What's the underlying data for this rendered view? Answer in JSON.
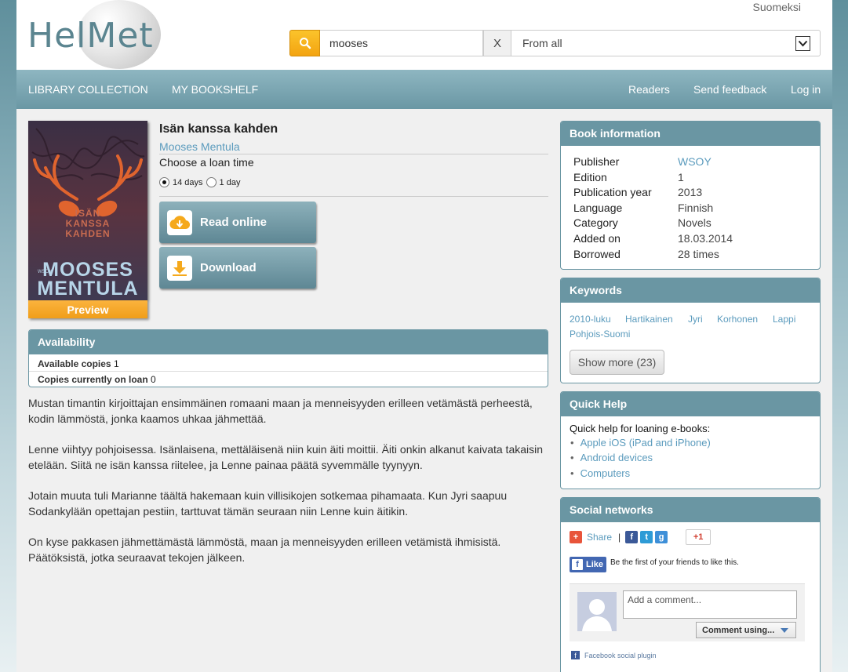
{
  "header": {
    "logo_text": "HelMet",
    "language_link": "Suomeksi",
    "search_value": "mooses",
    "clear_label": "X",
    "scope_value": "From all"
  },
  "nav": {
    "left": [
      "LIBRARY COLLECTION",
      "MY BOOKSHELF"
    ],
    "right": [
      "Readers",
      "Send feedback",
      "Log in"
    ]
  },
  "cover": {
    "title_lines": [
      "ISÄN",
      "KANSSA",
      "KAHDEN"
    ],
    "author_lines": [
      "MOOSES",
      "MENTULA"
    ],
    "publisher_mark": "WSOY",
    "preview_label": "Preview"
  },
  "book": {
    "title": "Isän kanssa kahden",
    "author": "Mooses Mentula",
    "loan_label": "Choose a loan time",
    "loan_options": [
      {
        "label": "14 days",
        "selected": true
      },
      {
        "label": "1 day",
        "selected": false
      }
    ],
    "read_online_label": "Read online",
    "download_label": "Download"
  },
  "availability": {
    "heading": "Availability",
    "available_label": "Available copies",
    "available_value": "1",
    "on_loan_label": "Copies currently on loan",
    "on_loan_value": "0"
  },
  "description": [
    "Mustan timantin kirjoittajan ensimmäinen romaani maan ja menneisyyden erilleen vetämästä perheestä, kodin lämmöstä, jonka kaamos uhkaa jähmettää.",
    "Lenne viihtyy pohjoisessa. Isänlaisena, mettäläisenä niin kuin äiti moittii. Äiti onkin alkanut kaivata takaisin etelään. Siitä ne isän kanssa riitelee, ja Lenne painaa päätä syvemmälle tyynyyn.",
    "Jotain muuta tuli Marianne täältä hakemaan kuin villisikojen sotkemaa pihamaata. Kun Jyri saapuu Sodankylään opettajan pestiin, tarttuvat tämän seuraan niin Lenne kuin äitikin.",
    "On kyse pakkasen jähmettämästä lämmöstä, maan ja menneisyyden erilleen vetämistä ihmisistä. Päätöksistä, jotka seuraavat tekojen jälkeen."
  ],
  "book_info": {
    "heading": "Book information",
    "rows": [
      {
        "label": "Publisher",
        "value": "WSOY"
      },
      {
        "label": "Edition",
        "value": "1"
      },
      {
        "label": "Publication year",
        "value": "2013"
      },
      {
        "label": "Language",
        "value": "Finnish"
      },
      {
        "label": "Category",
        "value": "Novels"
      },
      {
        "label": "Added on",
        "value": "18.03.2014"
      },
      {
        "label": "Borrowed",
        "value": "28 times"
      }
    ]
  },
  "keywords": {
    "heading": "Keywords",
    "items": [
      "2010-luku",
      "Hartikainen",
      "Jyri",
      "Korhonen",
      "Lappi",
      "Pohjois-Suomi"
    ],
    "show_more_label": "Show more (23)"
  },
  "quick_help": {
    "heading": "Quick Help",
    "intro": "Quick help for loaning e-books:",
    "items": [
      "Apple iOS (iPad and iPhone)",
      "Android devices",
      "Computers"
    ]
  },
  "social": {
    "heading": "Social networks",
    "share_label": "Share",
    "separator": "|",
    "gplus_label": "+1",
    "like_label": "Like",
    "like_text": "Be the first of your friends to like this.",
    "comment_placeholder": "Add a comment...",
    "comment_using_label": "Comment using...",
    "plugin_label": "Facebook social plugin"
  },
  "colors": {
    "accent": "#6a96a3",
    "link": "#5b9bbd",
    "search_button": "#f7b41f",
    "preview_button": "#f4a52a"
  }
}
